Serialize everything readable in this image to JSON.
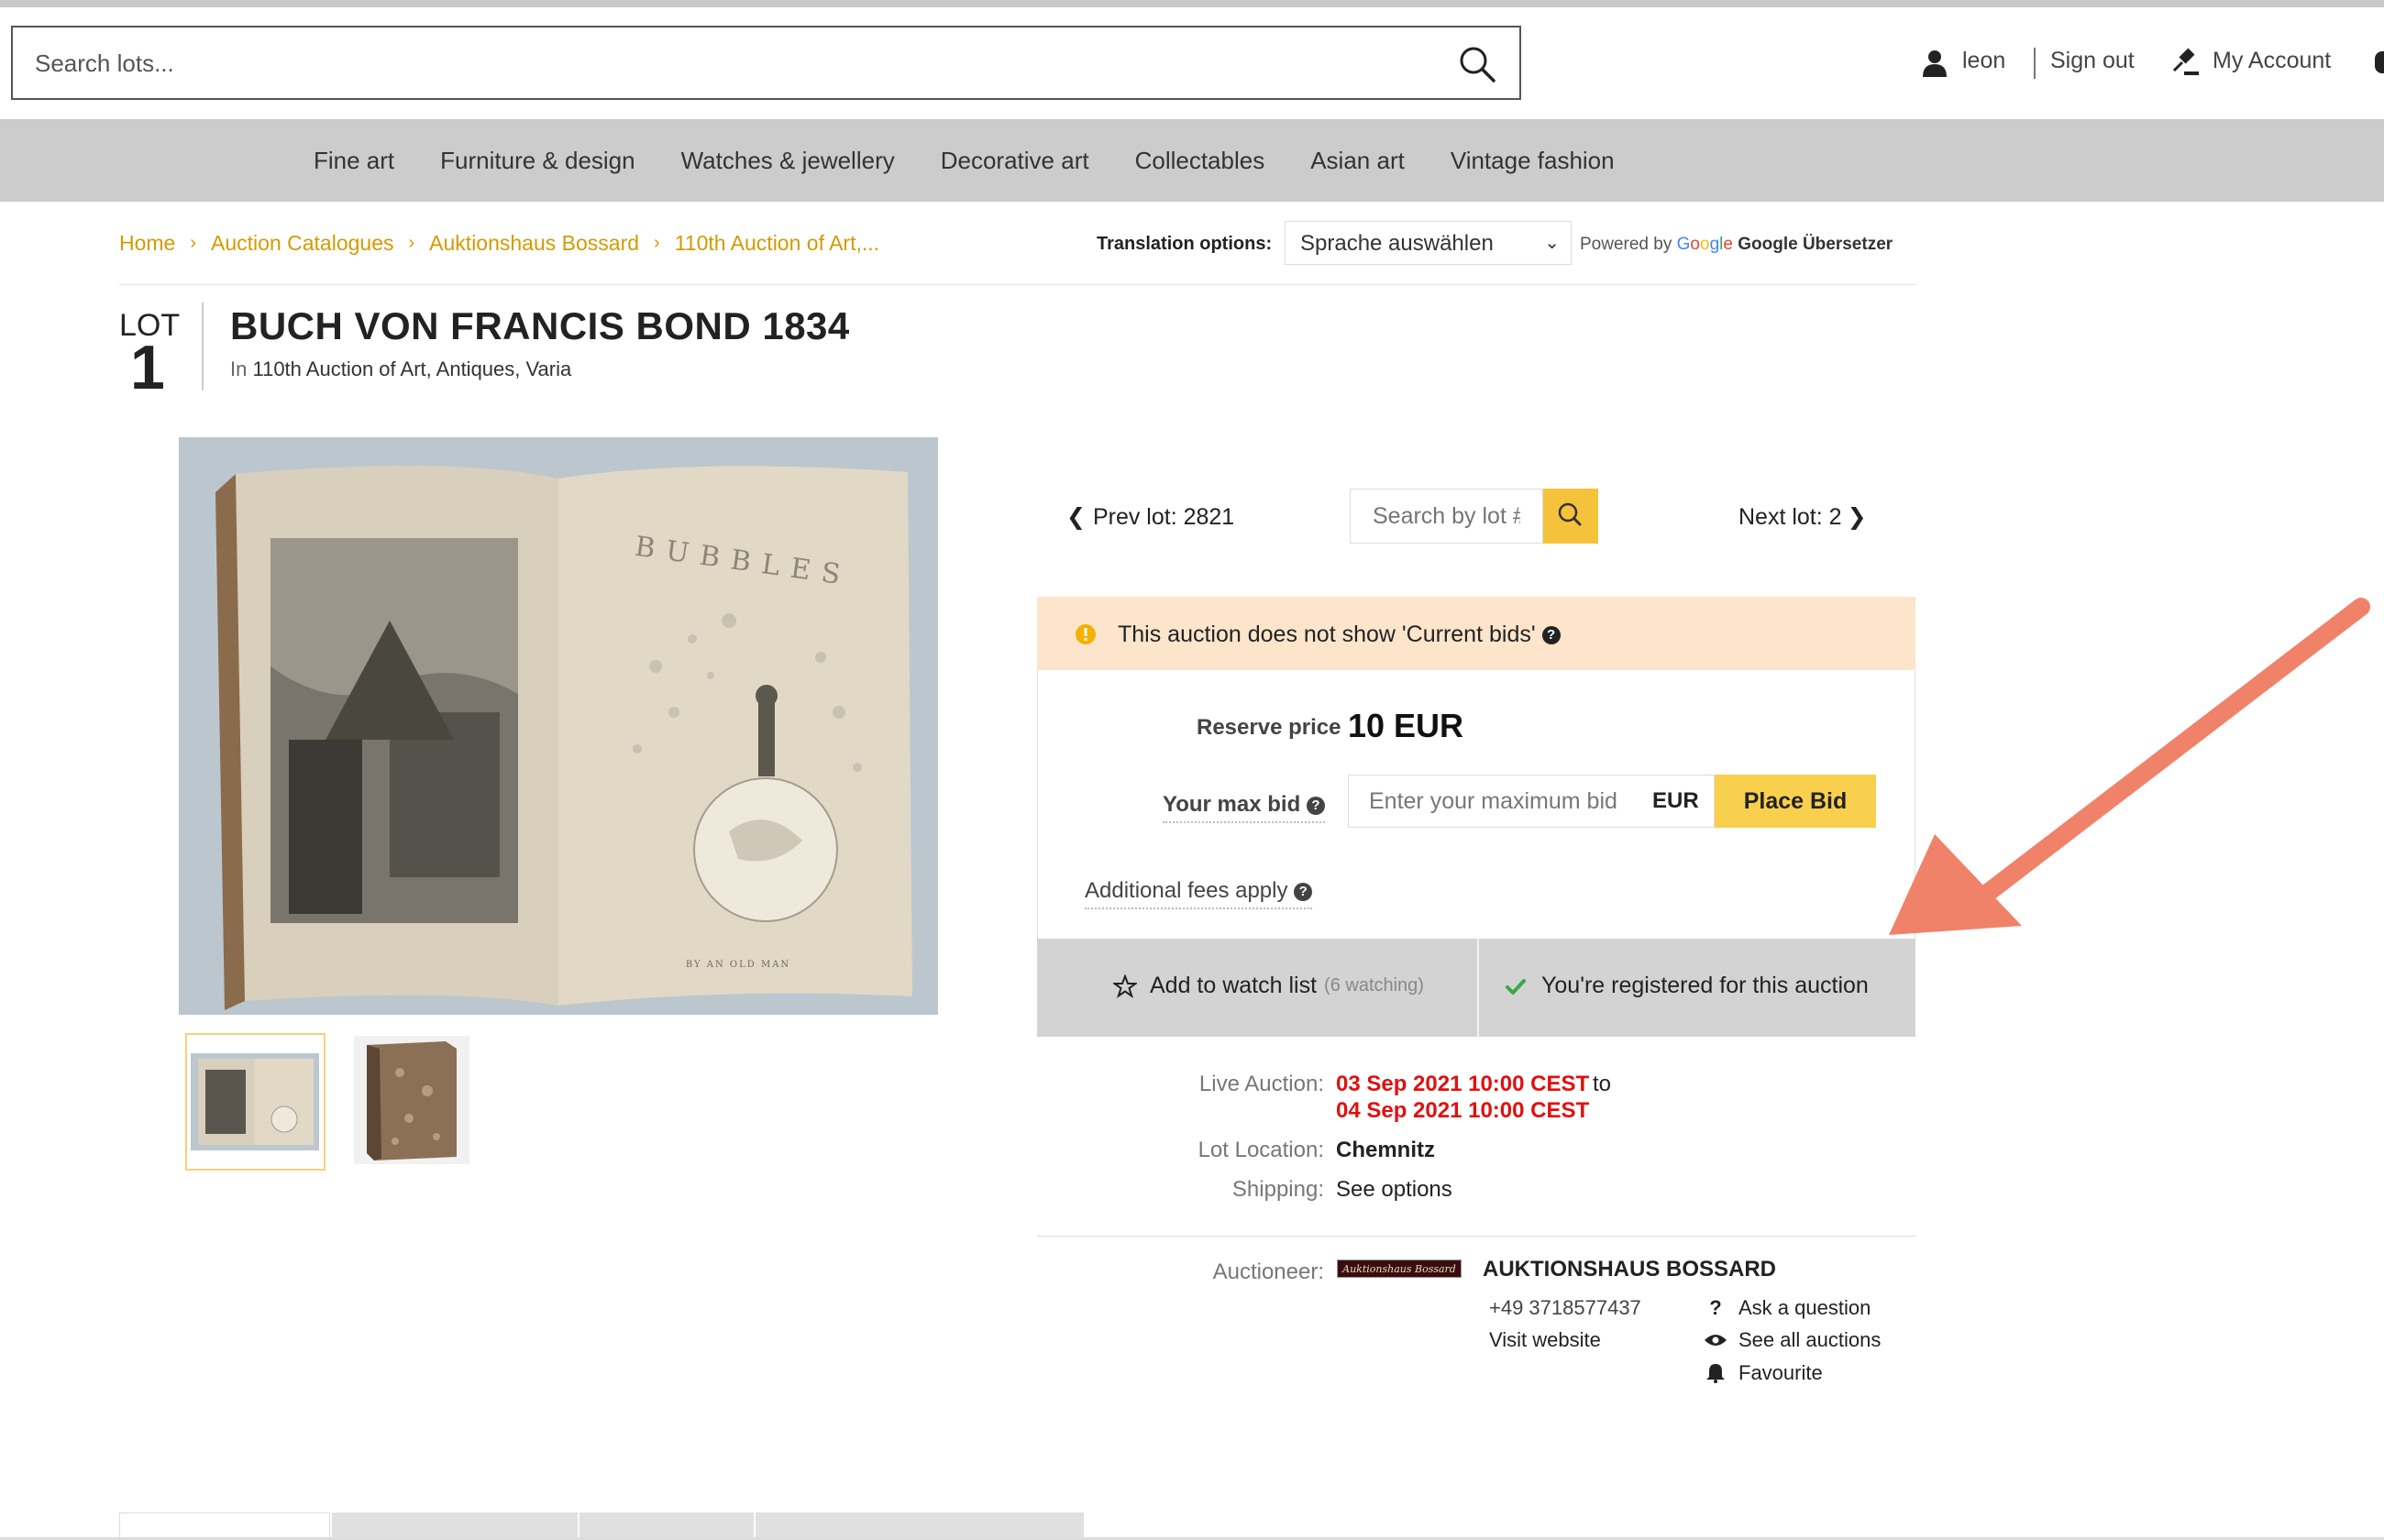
{
  "search": {
    "placeholder": "Search lots..."
  },
  "header": {
    "user_name": "leon",
    "sign_out": "Sign out",
    "my_account": "My Account"
  },
  "nav": {
    "categories": [
      "Fine art",
      "Furniture & design",
      "Watches & jewellery",
      "Decorative art",
      "Collectables",
      "Asian art",
      "Vintage fashion"
    ]
  },
  "breadcrumb": [
    "Home",
    "Auction Catalogues",
    "Auktionshaus Bossard",
    "110th Auction of Art,..."
  ],
  "translation": {
    "label": "Translation options:",
    "selected": "Sprache auswählen",
    "powered_by": "Powered by",
    "google_letters": [
      "G",
      "o",
      "o",
      "g",
      "l",
      "e"
    ],
    "service": "Google Übersetzer"
  },
  "lot": {
    "label": "LOT",
    "number": "1",
    "title": "BUCH VON FRANCIS BOND 1834",
    "in_prefix": "In",
    "auction_name": "110th Auction of Art, Antiques, Varia"
  },
  "lot_nav": {
    "prev": "Prev lot: 2821",
    "search_placeholder": "Search by lot #",
    "next": "Next lot: 2"
  },
  "bid_panel": {
    "notice": "This auction does not show 'Current bids'",
    "reserve_label": "Reserve price",
    "reserve_value": "10 EUR",
    "max_bid_label": "Your max bid",
    "max_bid_placeholder": "Enter your maximum bid",
    "currency": "EUR",
    "place_bid": "Place Bid",
    "fees": "Additional fees apply",
    "watch_label": "Add to watch list",
    "watch_count": "(6 watching)",
    "registered": "You're registered for this auction"
  },
  "auction_info": {
    "live_label": "Live Auction:",
    "start": "03 Sep 2021 10:00 CEST",
    "to": "to",
    "end": "04 Sep 2021 10:00 CEST",
    "location_label": "Lot Location:",
    "location": "Chemnitz",
    "shipping_label": "Shipping:",
    "shipping": "See options"
  },
  "auctioneer": {
    "label": "Auctioneer:",
    "logo_text": "Auktionshaus Bossard",
    "name": "AUKTIONSHAUS BOSSARD",
    "phone": "+49 3718577437",
    "website": "Visit website",
    "ask": "Ask a question",
    "see_all": "See all auctions",
    "favourite": "Favourite"
  },
  "image": {
    "book_title": "BUBBLES",
    "byline": "BY AN OLD MAN"
  },
  "colors": {
    "accent": "#f5c33b",
    "breadcrumb": "#d49a00",
    "date_red": "#e01010",
    "notice_bg": "#fde5cc",
    "arrow": "#f0826a"
  }
}
